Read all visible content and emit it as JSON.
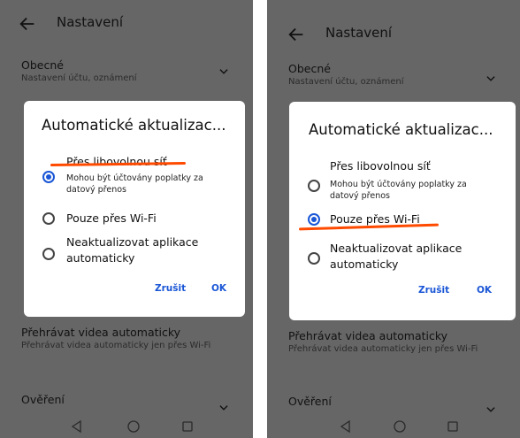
{
  "screen_left": {
    "header": {
      "title": "Nastavení"
    },
    "section_general": {
      "title": "Obecné",
      "subtitle": "Nastavení účtu, oznámení"
    },
    "section_autoplay": {
      "title": "Přehrávat videa automaticky",
      "subtitle": "Přehrávat videa automaticky jen přes Wi-Fi"
    },
    "section_verification": {
      "title": "Ověření"
    },
    "dialog": {
      "title": "Automatické aktualizac...",
      "options": [
        {
          "label": "Přes libovolnou síť",
          "sublabel_line1": "Mohou být účtovány poplatky za",
          "sublabel_line2": "datový přenos",
          "selected": true
        },
        {
          "label": "Pouze přes Wi-Fi",
          "selected": false
        },
        {
          "label_line1": "Neaktualizovat aplikace",
          "label_line2": "automaticky",
          "selected": false
        }
      ],
      "cancel_label": "Zrušit",
      "ok_label": "OK"
    }
  },
  "screen_right": {
    "header": {
      "title": "Nastavení"
    },
    "section_general": {
      "title": "Obecné",
      "subtitle": "Nastavení účtu, oznámení"
    },
    "section_autoplay": {
      "title": "Přehrávat videa automaticky",
      "subtitle": "Přehrávat videa automaticky jen přes Wi-Fi"
    },
    "section_verification": {
      "title": "Ověření"
    },
    "dialog": {
      "title": "Automatické aktualizac...",
      "options": [
        {
          "label": "Přes libovolnou síť",
          "sublabel_line1": "Mohou být účtovány poplatky za",
          "sublabel_line2": "datový přenos",
          "selected": false
        },
        {
          "label": "Pouze přes Wi-Fi",
          "selected": true
        },
        {
          "label_line1": "Neaktualizovat aplikace",
          "label_line2": "automaticky",
          "selected": false
        }
      ],
      "cancel_label": "Zrušit",
      "ok_label": "OK"
    }
  },
  "colors": {
    "scrim_background": "#666666",
    "accent_blue": "#1a56d6",
    "annotation_underline": "#ff4a00"
  },
  "icons": {
    "back": "arrow-left-icon",
    "expand": "chevron-down-icon",
    "nav_back": "triangle-back-icon",
    "nav_home": "circle-home-icon",
    "nav_recents": "square-recents-icon"
  }
}
